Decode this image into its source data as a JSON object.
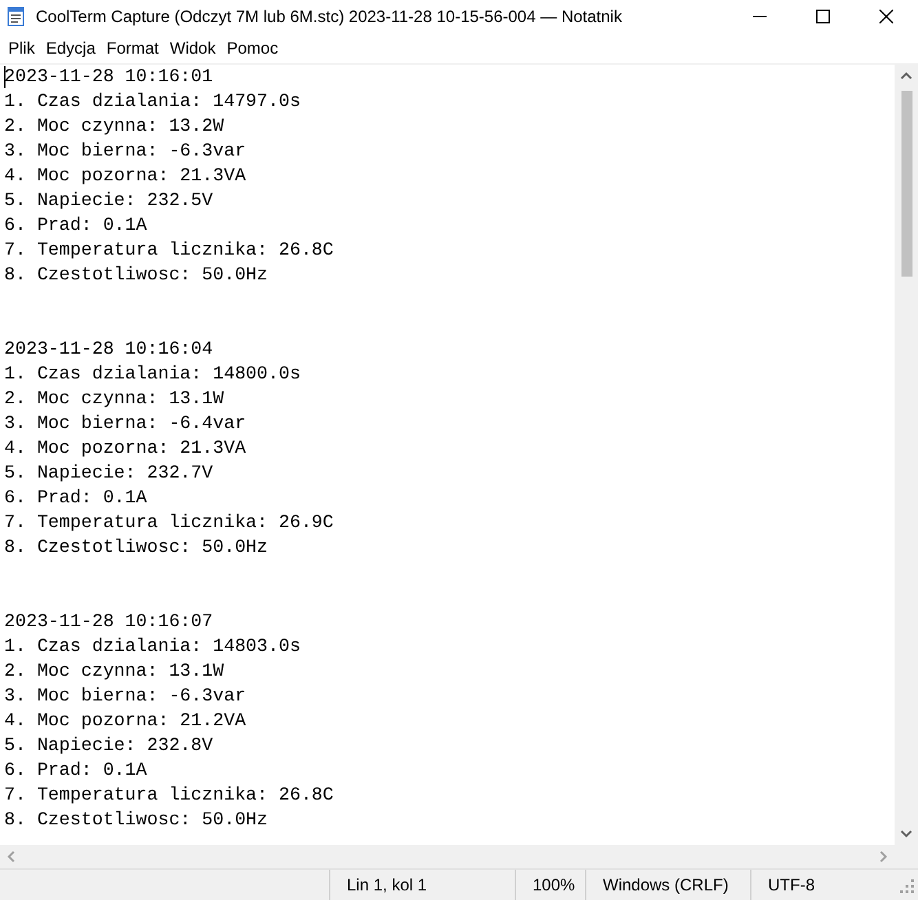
{
  "window": {
    "title": "CoolTerm Capture (Odczyt 7M lub 6M.stc) 2023-11-28 10-15-56-004 — Notatnik"
  },
  "menu": [
    "Plik",
    "Edycja",
    "Format",
    "Widok",
    "Pomoc"
  ],
  "document": {
    "entries": [
      {
        "timestamp": "2023-11-28 10:16:01",
        "lines": [
          "1. Czas dzialania: 14797.0s",
          "2. Moc czynna: 13.2W",
          "3. Moc bierna: -6.3var",
          "4. Moc pozorna: 21.3VA",
          "5. Napiecie: 232.5V",
          "6. Prad: 0.1A",
          "7. Temperatura licznika: 26.8C",
          "8. Czestotliwosc: 50.0Hz"
        ]
      },
      {
        "timestamp": "2023-11-28 10:16:04",
        "lines": [
          "1. Czas dzialania: 14800.0s",
          "2. Moc czynna: 13.1W",
          "3. Moc bierna: -6.4var",
          "4. Moc pozorna: 21.3VA",
          "5. Napiecie: 232.7V",
          "6. Prad: 0.1A",
          "7. Temperatura licznika: 26.9C",
          "8. Czestotliwosc: 50.0Hz"
        ]
      },
      {
        "timestamp": "2023-11-28 10:16:07",
        "lines": [
          "1. Czas dzialania: 14803.0s",
          "2. Moc czynna: 13.1W",
          "3. Moc bierna: -6.3var",
          "4. Moc pozorna: 21.2VA",
          "5. Napiecie: 232.8V",
          "6. Prad: 0.1A",
          "7. Temperatura licznika: 26.8C",
          "8. Czestotliwosc: 50.0Hz"
        ]
      }
    ]
  },
  "status_bar": {
    "position": "Lin 1, kol 1",
    "zoom": "100%",
    "line_ending": "Windows (CRLF)",
    "encoding": "UTF-8"
  }
}
